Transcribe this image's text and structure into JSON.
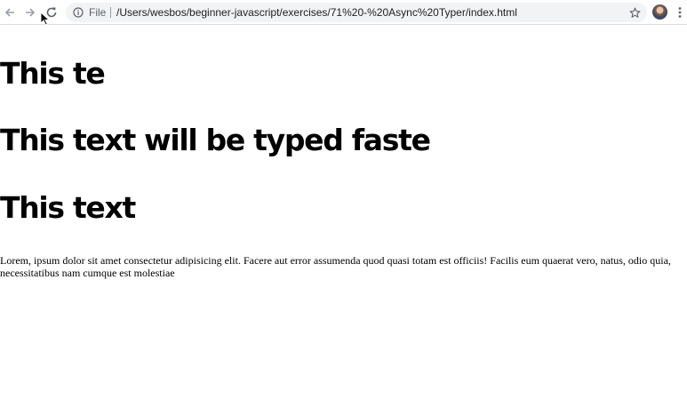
{
  "toolbar": {
    "back_icon": "back-arrow-icon",
    "forward_icon": "forward-arrow-icon",
    "reload_icon": "reload-icon",
    "scheme_label": "File",
    "url": "/Users/wesbos/beginner-javascript/exercises/71%20-%20Async%20Typer/index.html",
    "info_icon": "info-icon",
    "bookmark_icon": "star-icon",
    "menu_icon": "more-vert-icon"
  },
  "page": {
    "headings": [
      "This te",
      "This text will be typed faste",
      "This text"
    ],
    "paragraph": "Lorem, ipsum dolor sit amet consectetur adipisicing elit. Facere aut error assumenda quod quasi totam est officiis! Facilis eum quaerat vero, natus, odio quia, necessitatibus nam cumque est molestiae"
  },
  "colors": {
    "omnibox_bg": "#f1f3f4",
    "text": "#000000",
    "icon": "#5f6368"
  }
}
